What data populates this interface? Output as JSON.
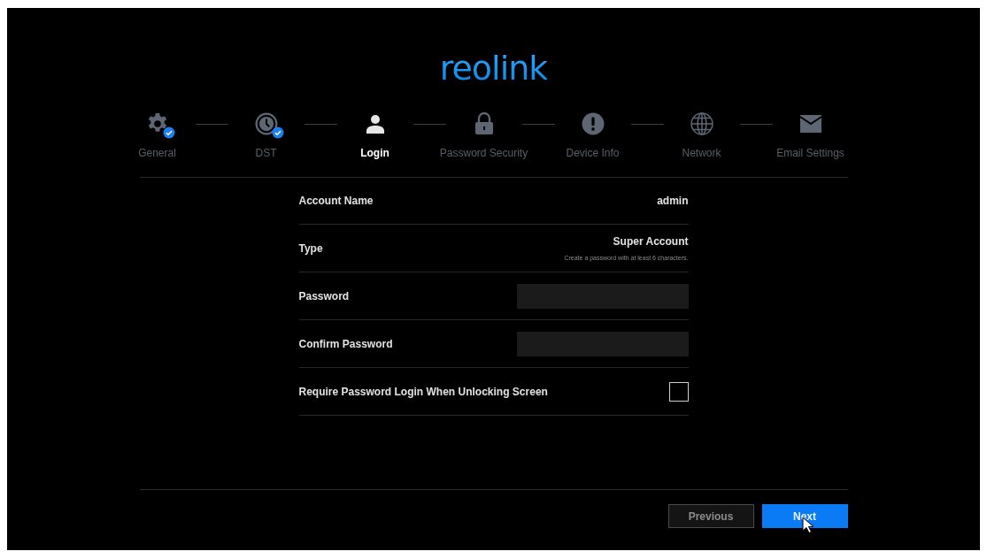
{
  "logo": "reolink",
  "steps": [
    {
      "label": "General",
      "done": true,
      "selected": false
    },
    {
      "label": "DST",
      "done": true,
      "selected": false
    },
    {
      "label": "Login",
      "done": false,
      "selected": true
    },
    {
      "label": "Password Security",
      "done": false,
      "selected": false
    },
    {
      "label": "Device Info",
      "done": false,
      "selected": false
    },
    {
      "label": "Network",
      "done": false,
      "selected": false
    },
    {
      "label": "Email Settings",
      "done": false,
      "selected": false
    }
  ],
  "form": {
    "rows": [
      {
        "kind": "value",
        "label": "Account Name",
        "value": "admin"
      },
      {
        "kind": "value",
        "label": "Type",
        "value": "Super Account",
        "hint": "Create a password with at least 6 characters."
      },
      {
        "kind": "input",
        "label": "Password"
      },
      {
        "kind": "input",
        "label": "Confirm Password"
      },
      {
        "kind": "checkbox",
        "label": "Require Password Login When Unlocking Screen",
        "checked": false
      }
    ]
  },
  "buttons": [
    {
      "label": "Previous",
      "kind": "secondary"
    },
    {
      "label": "Next",
      "kind": "primary"
    }
  ]
}
